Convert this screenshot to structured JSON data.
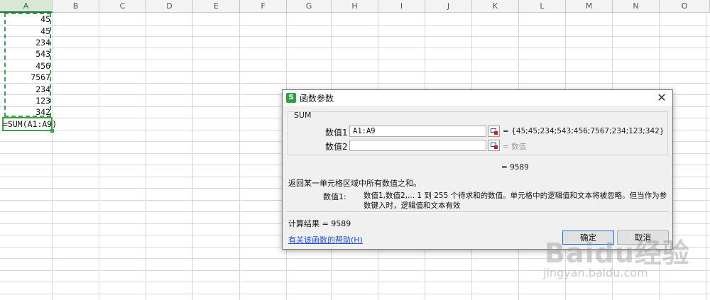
{
  "spreadsheet": {
    "columns": [
      "A",
      "B",
      "C",
      "D",
      "E",
      "F",
      "G",
      "H",
      "I",
      "J",
      "K",
      "L",
      "M",
      "N",
      "O"
    ],
    "active_column": "A",
    "cells_a": [
      "45",
      "45",
      "234",
      "543",
      "456",
      "7567",
      "234",
      "123",
      "342"
    ],
    "active_cell_formula": "=SUM(A1:A9)"
  },
  "dialog": {
    "title": "函数参数",
    "app_icon": "S",
    "close_glyph": "✕",
    "function_name": "SUM",
    "args": [
      {
        "label": "数值1",
        "value": "A1:A9",
        "result": "= {45;45;234;543;456;7567;234;123;342}"
      },
      {
        "label": "数值2",
        "value": "",
        "result": "= 数值"
      }
    ],
    "equals_total": "= 9589",
    "description": "返回某一单元格区域中所有数值之和。",
    "param_name": "数值1:",
    "param_desc": "数值1,数值2,... 1 到 255 个待求和的数值。单元格中的逻辑值和文本将被忽略。但当作为参数键入时，逻辑值和文本有效",
    "result_line": "计算结果 = 9589",
    "help_link": "有关该函数的帮助(H)",
    "ok_label": "确定",
    "cancel_label": "取消"
  },
  "watermark": {
    "main": "Baidu经验",
    "sub": "jingyan.baidu.com"
  },
  "colors": {
    "accent_green": "#3aa34a",
    "link_blue": "#1f4fd1"
  }
}
